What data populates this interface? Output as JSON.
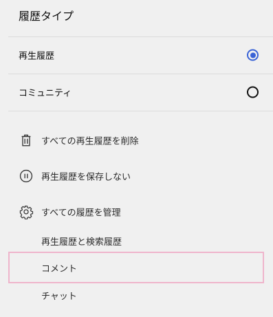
{
  "section": {
    "title": "履歴タイプ"
  },
  "history_types": [
    {
      "label": "再生履歴",
      "selected": true
    },
    {
      "label": "コミュニティ",
      "selected": false
    }
  ],
  "actions": [
    {
      "label": "すべての再生履歴を削除",
      "icon": "trash-icon"
    },
    {
      "label": "再生履歴を保存しない",
      "icon": "pause-circle-icon"
    },
    {
      "label": "すべての履歴を管理",
      "icon": "gear-icon"
    }
  ],
  "manage_links": [
    {
      "label": "再生履歴と検索履歴"
    },
    {
      "label": "コメント"
    },
    {
      "label": "チャット"
    }
  ],
  "colors": {
    "background": "#f0f0f0",
    "radio_selected": "#3a63d6",
    "highlight_border": "#efb4cb",
    "divider": "#dcdcdc"
  }
}
